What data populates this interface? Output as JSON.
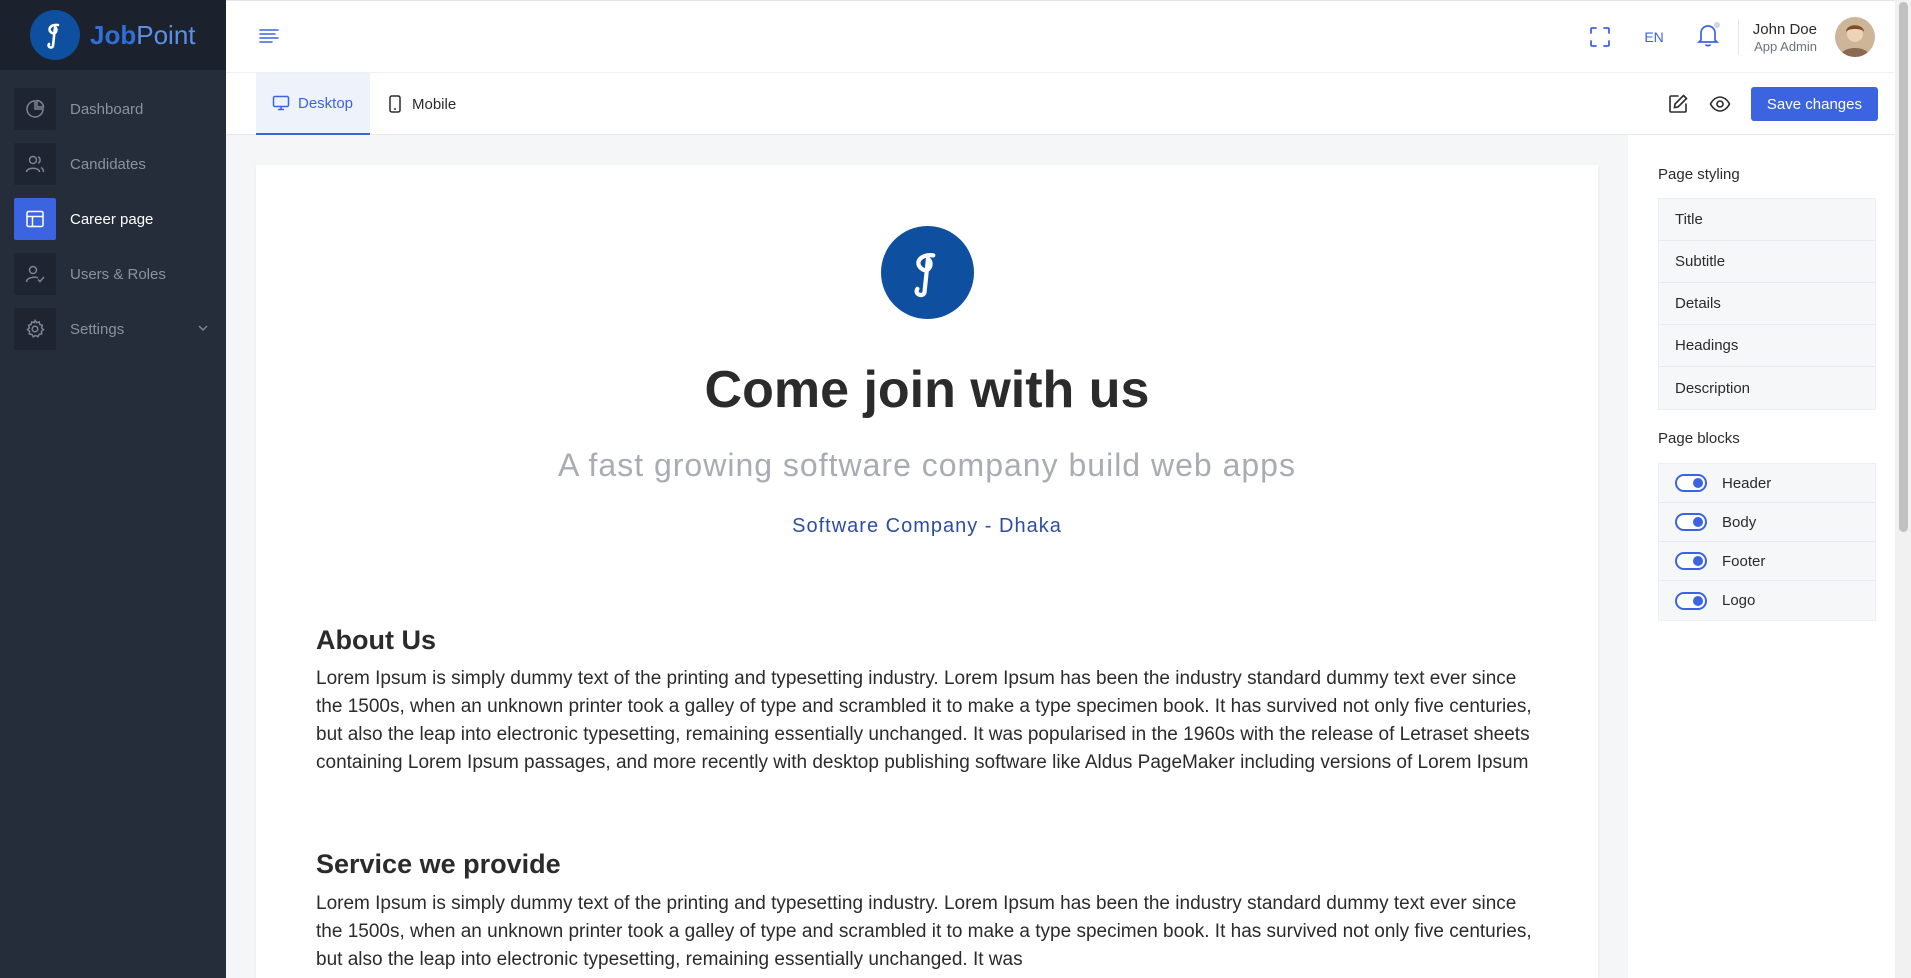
{
  "app": {
    "brand_part1": "Job",
    "brand_part2": "Point",
    "accent_color": "#3c64e1",
    "sidebar_color": "#252d3b"
  },
  "sidebar": {
    "items": [
      {
        "label": "Dashboard",
        "icon": "pie-chart-icon",
        "active": false
      },
      {
        "label": "Candidates",
        "icon": "users-icon",
        "active": false
      },
      {
        "label": "Career page",
        "icon": "layout-icon",
        "active": true
      },
      {
        "label": "Users & Roles",
        "icon": "user-check-icon",
        "active": false
      },
      {
        "label": "Settings",
        "icon": "gear-icon",
        "active": false,
        "has_submenu": true
      }
    ]
  },
  "header": {
    "language": "EN",
    "user_name": "John Doe",
    "user_role": "App Admin"
  },
  "tabs": [
    {
      "label": "Desktop",
      "icon": "monitor-icon",
      "active": true
    },
    {
      "label": "Mobile",
      "icon": "smartphone-icon",
      "active": false
    }
  ],
  "actions": {
    "save_label": "Save changes"
  },
  "preview": {
    "title": "Come join with us",
    "subtitle": "A fast growing software company build web apps",
    "details": "Software Company - Dhaka",
    "sections": [
      {
        "heading": "About Us",
        "description": "Lorem Ipsum is simply dummy text of the printing and typesetting industry. Lorem Ipsum has been the industry standard dummy text ever since the 1500s, when an unknown printer took a galley of type and scrambled it to make a type specimen book. It has survived not only five centuries, but also the leap into electronic typesetting, remaining essentially unchanged. It was popularised in the 1960s with the release of Letraset sheets containing Lorem Ipsum passages, and more recently with desktop publishing software like Aldus PageMaker including versions of Lorem Ipsum"
      },
      {
        "heading": "Service we provide",
        "description": "Lorem Ipsum is simply dummy text of the printing and typesetting industry. Lorem Ipsum has been the industry standard dummy text ever since the 1500s, when an unknown printer took a galley of type and scrambled it to make a type specimen book. It has survived not only five centuries, but also the leap into electronic typesetting, remaining essentially unchanged. It was"
      }
    ]
  },
  "right_panel": {
    "styling_title": "Page styling",
    "styling_items": [
      "Title",
      "Subtitle",
      "Details",
      "Headings",
      "Description"
    ],
    "blocks_title": "Page blocks",
    "blocks": [
      {
        "label": "Header",
        "enabled": true
      },
      {
        "label": "Body",
        "enabled": true
      },
      {
        "label": "Footer",
        "enabled": true
      },
      {
        "label": "Logo",
        "enabled": true
      }
    ]
  }
}
